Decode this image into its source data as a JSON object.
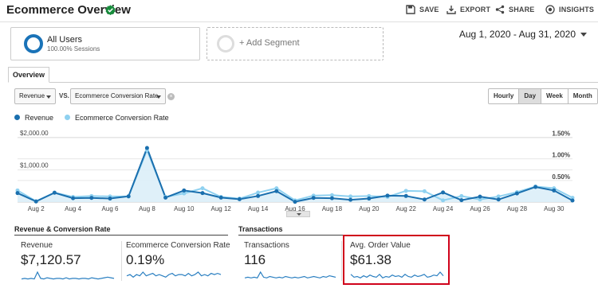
{
  "header": {
    "title": "Ecommerce Overview",
    "actions": [
      {
        "label": "SAVE",
        "icon": "save-icon"
      },
      {
        "label": "EXPORT",
        "icon": "export-icon"
      },
      {
        "label": "SHARE",
        "icon": "share-icon"
      },
      {
        "label": "INSIGHTS",
        "icon": "insights-icon"
      }
    ]
  },
  "segments": {
    "primary": {
      "name": "All Users",
      "subtitle": "100.00% Sessions",
      "color": "#1a73b8"
    },
    "add_label": "+ Add Segment"
  },
  "date_range": "Aug 1, 2020 - Aug 31, 2020",
  "tabs": {
    "overview": "Overview"
  },
  "controls": {
    "metric1": "Revenue",
    "vs": "VS.",
    "metric2": "Ecommerce Conversion Rate",
    "clear": "×",
    "granularity": [
      "Hourly",
      "Day",
      "Week",
      "Month"
    ],
    "active_granularity": "Day"
  },
  "legend": [
    {
      "label": "Revenue",
      "color": "#1a6fae"
    },
    {
      "label": "Ecommerce Conversion Rate",
      "color": "#8fd1f0"
    }
  ],
  "chart_data": {
    "type": "line",
    "x": [
      "Aug 1",
      "Aug 2",
      "Aug 3",
      "Aug 4",
      "Aug 5",
      "Aug 6",
      "Aug 7",
      "Aug 8",
      "Aug 9",
      "Aug 10",
      "Aug 11",
      "Aug 12",
      "Aug 13",
      "Aug 14",
      "Aug 15",
      "Aug 16",
      "Aug 17",
      "Aug 18",
      "Aug 19",
      "Aug 20",
      "Aug 21",
      "Aug 22",
      "Aug 23",
      "Aug 24",
      "Aug 25",
      "Aug 26",
      "Aug 27",
      "Aug 28",
      "Aug 29",
      "Aug 30",
      "Aug 31"
    ],
    "xticks": [
      "Aug 2",
      "Aug 4",
      "Aug 6",
      "Aug 8",
      "Aug 10",
      "Aug 12",
      "Aug 14",
      "Aug 16",
      "Aug 18",
      "Aug 20",
      "Aug 22",
      "Aug 24",
      "Aug 26",
      "Aug 28",
      "Aug 30"
    ],
    "left_axis": {
      "ticks": [
        "$1,000.00",
        "$2,000.00"
      ],
      "tick_values": [
        1000,
        2000
      ],
      "ylim": [
        0,
        2150
      ]
    },
    "right_axis": {
      "ticks": [
        "0.50%",
        "1.00%",
        "1.50%"
      ],
      "tick_values": [
        0.5,
        1.0,
        1.5
      ],
      "ylim": [
        0,
        1.6
      ]
    },
    "series": [
      {
        "name": "Revenue",
        "axis": "left",
        "color": "#1a6fae",
        "values": [
          280,
          20,
          290,
          120,
          130,
          110,
          180,
          1680,
          140,
          360,
          280,
          140,
          90,
          190,
          340,
          10,
          130,
          120,
          70,
          110,
          200,
          190,
          80,
          300,
          60,
          170,
          80,
          270,
          470,
          360,
          50
        ]
      },
      {
        "name": "Ecommerce Conversion Rate",
        "axis": "right",
        "color": "#8fd1f0",
        "values": [
          0.27,
          0.02,
          0.22,
          0.12,
          0.14,
          0.13,
          0.13,
          1.2,
          0.12,
          0.2,
          0.32,
          0.12,
          0.08,
          0.22,
          0.32,
          0.04,
          0.15,
          0.16,
          0.13,
          0.14,
          0.12,
          0.26,
          0.25,
          0.04,
          0.14,
          0.06,
          0.13,
          0.23,
          0.36,
          0.32,
          0.1
        ]
      }
    ],
    "grid": true
  },
  "groups": {
    "revenue_conv": "Revenue & Conversion Rate",
    "transactions": "Transactions"
  },
  "cards": [
    {
      "label": "Revenue",
      "value": "$7,120.57",
      "spark": [
        3,
        4,
        3,
        4,
        3,
        14,
        4,
        3,
        5,
        4,
        3,
        4,
        4,
        3,
        5,
        3,
        4,
        4,
        3,
        4,
        4,
        3,
        5,
        4,
        3,
        4,
        5,
        6,
        5,
        4
      ]
    },
    {
      "label": "Ecommerce Conversion Rate",
      "value": "0.19%",
      "spark": [
        4,
        5,
        3,
        5,
        4,
        7,
        4,
        5,
        6,
        4,
        5,
        4,
        3,
        5,
        6,
        4,
        5,
        5,
        4,
        6,
        4,
        5,
        7,
        4,
        5,
        4,
        6,
        5,
        6,
        5
      ]
    },
    {
      "label": "Transactions",
      "value": "116",
      "spark": [
        4,
        5,
        4,
        5,
        4,
        12,
        5,
        4,
        6,
        5,
        4,
        5,
        4,
        6,
        5,
        4,
        5,
        4,
        5,
        6,
        4,
        5,
        6,
        5,
        4,
        6,
        5,
        7,
        6,
        5
      ]
    },
    {
      "label": "Avg. Order Value",
      "value": "$61.38",
      "spark": [
        9,
        5,
        6,
        4,
        7,
        5,
        8,
        6,
        5,
        9,
        4,
        6,
        5,
        8,
        6,
        7,
        5,
        9,
        6,
        5,
        8,
        6,
        7,
        9,
        5,
        6,
        8,
        7,
        12,
        7
      ]
    }
  ]
}
